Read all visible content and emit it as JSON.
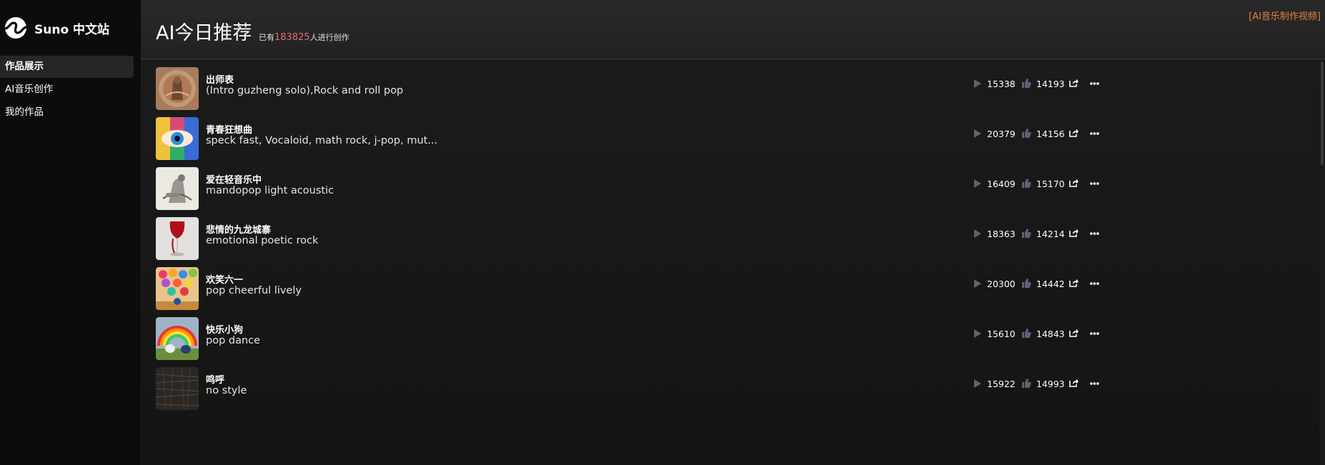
{
  "brand": {
    "name": "Suno 中文站"
  },
  "nav": [
    {
      "label": "作品展示",
      "active": true
    },
    {
      "label": "AI音乐创作",
      "active": false
    },
    {
      "label": "我的作品",
      "active": false
    }
  ],
  "header": {
    "title": "AI今日推荐",
    "stats_prefix": "已有",
    "stats_count": "183825",
    "stats_suffix": "人进行创作",
    "promo_link": "[AI音乐制作视频]"
  },
  "songs": [
    {
      "title": "出师表",
      "style": "(Intro guzheng solo),Rock and roll pop",
      "plays": "15338",
      "likes": "14193",
      "cover": "guzheng-bird"
    },
    {
      "title": "青春狂想曲",
      "style": "speck fast, Vocaloid, math rock, j-pop, mut...",
      "plays": "20379",
      "likes": "14156",
      "cover": "rainbow-eye"
    },
    {
      "title": "爱在轻音乐中",
      "style": "mandopop light acoustic",
      "plays": "16409",
      "likes": "15170",
      "cover": "sketch-bird-guitar"
    },
    {
      "title": "悲情的九龙城寨",
      "style": "emotional poetic rock",
      "plays": "18363",
      "likes": "14214",
      "cover": "wine-glass"
    },
    {
      "title": "欢笑六一",
      "style": "pop cheerful lively",
      "plays": "20300",
      "likes": "14442",
      "cover": "balloons"
    },
    {
      "title": "快乐小狗",
      "style": "pop dance",
      "plays": "15610",
      "likes": "14843",
      "cover": "rainbow-dogs"
    },
    {
      "title": "鸣呼",
      "style": "no style",
      "plays": "15922",
      "likes": "14993",
      "cover": "dark-texture"
    }
  ],
  "colors": {
    "accent_count": "#e66b6b",
    "promo": "#e2813f",
    "icon_muted": "#5b6477"
  }
}
